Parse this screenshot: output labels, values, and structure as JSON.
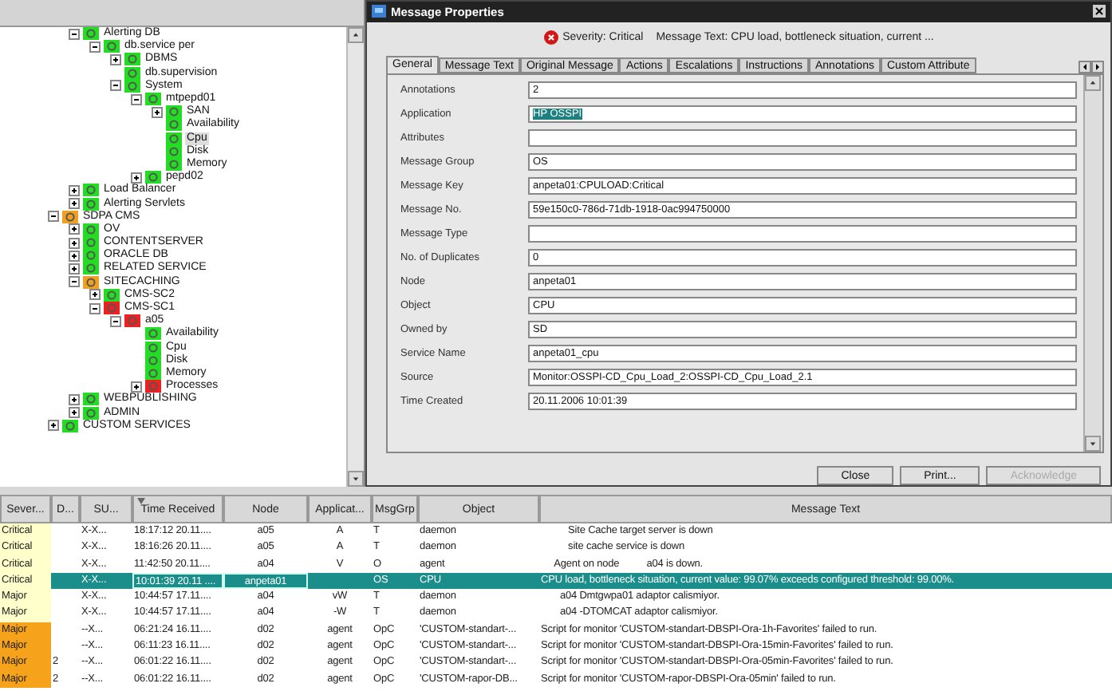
{
  "tree": {
    "continued": [
      {
        "label": "Alerting DB",
        "color": "#22dd22",
        "selected": false,
        "expanded": true,
        "children": [
          {
            "label": "db.service per",
            "color": "#22dd22",
            "selected": false,
            "expanded": true,
            "children": [
              {
                "label": "DBMS",
                "color": "#22dd22",
                "selected": false,
                "expanded": false
              },
              {
                "label": "db.supervision",
                "color": "#22dd22",
                "selected": false
              },
              {
                "label": "System",
                "color": "#22dd22",
                "selected": false,
                "expanded": true,
                "children": [
                  {
                    "label": "mtpepd01",
                    "color": "#22dd22",
                    "selected": false,
                    "expanded": true,
                    "children": [
                      {
                        "label": "SAN",
                        "color": "#22dd22",
                        "selected": false,
                        "expanded": false
                      },
                      {
                        "label": "Availability",
                        "color": "#22dd22",
                        "selected": false
                      },
                      {
                        "label": "Cpu",
                        "color": "#22dd22",
                        "selected": true
                      },
                      {
                        "label": "Disk",
                        "color": "#22dd22",
                        "selected": false
                      },
                      {
                        "label": "Memory",
                        "color": "#22dd22",
                        "selected": false
                      }
                    ]
                  },
                  {
                    "label": "pepd02",
                    "color": "#22dd22",
                    "selected": false,
                    "expanded": false
                  }
                ]
              }
            ]
          }
        ]
      },
      {
        "label": "Load Balancer",
        "color": "#22dd22",
        "selected": false,
        "expanded": false
      },
      {
        "label": "Alerting Servlets",
        "color": "#22dd22",
        "selected": false,
        "expanded": false
      }
    ],
    "items": [
      {
        "label": "SDPA CMS",
        "color": "#f0a020",
        "selected": false,
        "expanded": true,
        "children": [
          {
            "label": "OV",
            "color": "#22dd22",
            "selected": false,
            "expanded": false
          },
          {
            "label": "CONTENTSERVER",
            "color": "#22dd22",
            "selected": false,
            "expanded": false
          },
          {
            "label": "ORACLE DB",
            "color": "#22dd22",
            "selected": false,
            "expanded": false
          },
          {
            "label": "RELATED SERVICE",
            "color": "#22dd22",
            "selected": false,
            "expanded": false
          },
          {
            "label": "SITECACHING",
            "color": "#f0a020",
            "selected": false,
            "expanded": true,
            "children": [
              {
                "label": "CMS-SC2",
                "color": "#22dd22",
                "selected": false,
                "expanded": false
              },
              {
                "label": "CMS-SC1",
                "color": "#ee2020",
                "selected": false,
                "expanded": true,
                "children": [
                  {
                    "label": "a05",
                    "color": "#ee2020",
                    "selected": false,
                    "expanded": true,
                    "children": [
                      {
                        "label": "Availability",
                        "color": "#22dd22",
                        "selected": false
                      },
                      {
                        "label": "Cpu",
                        "color": "#22dd22",
                        "selected": false
                      },
                      {
                        "label": "Disk",
                        "color": "#22dd22",
                        "selected": false
                      },
                      {
                        "label": "Memory",
                        "color": "#22dd22",
                        "selected": false
                      },
                      {
                        "label": "Processes",
                        "color": "#ee2020",
                        "selected": false,
                        "expanded": false
                      }
                    ]
                  }
                ]
              }
            ]
          },
          {
            "label": "WEBPUBLISHING",
            "color": "#22dd22",
            "selected": false,
            "expanded": false
          },
          {
            "label": "ADMIN",
            "color": "#22dd22",
            "selected": false,
            "expanded": false
          }
        ]
      },
      {
        "label": "CUSTOM SERVICES",
        "color": "#22dd22",
        "selected": false,
        "expanded": false
      }
    ]
  },
  "dialog": {
    "title": "Message Properties",
    "severity": "Severity: Critical",
    "message": "Message Text: CPU load, bottleneck situation, current ...",
    "tabs": [
      {
        "label": "General",
        "selected": true
      },
      {
        "label": "Message Text",
        "selected": false
      },
      {
        "label": "Original Message",
        "selected": false
      },
      {
        "label": "Actions",
        "selected": false
      },
      {
        "label": "Escalations",
        "selected": false
      },
      {
        "label": "Instructions",
        "selected": false
      },
      {
        "label": "Annotations",
        "selected": false
      },
      {
        "label": "Custom Attribute",
        "selected": false
      }
    ],
    "fields": [
      {
        "label": "Annotations",
        "value": "2",
        "highlighted": false
      },
      {
        "label": "Application",
        "value": "HP OSSPI",
        "highlighted": true
      },
      {
        "label": "Attributes"
      },
      {
        "label": "Message Group",
        "value": "OS",
        "highlighted": false
      },
      {
        "label": "Message Key",
        "value": "anpeta01:CPULOAD:Critical",
        "highlighted": false
      },
      {
        "label": "Message No.",
        "value": "59e150c0-786d-71db-1918-0ac994750000",
        "highlighted": false
      },
      {
        "label": "Message Type"
      },
      {
        "label": "No. of Duplicates",
        "value": "0",
        "highlighted": false
      },
      {
        "label": "Node",
        "value": "anpeta01",
        "highlighted": false
      },
      {
        "label": "Object",
        "value": "CPU",
        "highlighted": false
      },
      {
        "label": "Owned by",
        "value": "SD",
        "highlighted": false
      },
      {
        "label": "Service Name",
        "value": "anpeta01_cpu",
        "highlighted": false
      },
      {
        "label": "Source",
        "value": "Monitor:OSSPI-CD_Cpu_Load_2:OSSPI-CD_Cpu_Load_2.1",
        "highlighted": false
      },
      {
        "label": "Time Created",
        "value": "20.11.2006 10:01:39",
        "highlighted": false
      }
    ],
    "buttons": [
      {
        "label": "Close",
        "disabled": false
      },
      {
        "label": "Print...",
        "disabled": false
      },
      {
        "label": "Acknowledge",
        "disabled": true
      }
    ]
  },
  "table": {
    "columns": [
      {
        "label": "Sever...",
        "sorted": false
      },
      {
        "label": "D...",
        "sorted": false
      },
      {
        "label": "SU...",
        "sorted": false
      },
      {
        "label": "Time Received",
        "sorted": true
      },
      {
        "label": "Node",
        "sorted": false
      },
      {
        "label": "Applicat...",
        "sorted": false
      },
      {
        "label": "MsgGrp",
        "sorted": false
      },
      {
        "label": "Object",
        "sorted": false
      },
      {
        "label": "Message Text",
        "sorted": false
      }
    ],
    "rows": [
      {
        "color": "#ffffcc",
        "selected": false,
        "cells": [
          "Critical",
          "",
          "X-X...",
          "18:17:12 20.11....",
          "a05",
          "A",
          "T",
          "daemon",
          "          Site Cache target server is down"
        ]
      },
      {
        "color": "#ffffcc",
        "selected": false,
        "cells": [
          "Critical",
          "",
          "X-X...",
          "18:16:26 20.11....",
          "a05",
          "A",
          "T",
          "daemon",
          "          site cache service is down"
        ]
      },
      {
        "color": "#ffffcc",
        "selected": false,
        "cells": [
          "Critical",
          "",
          "X-X...",
          "11:42:50 20.11....",
          "a04",
          "V",
          "O",
          "agent",
          "     Agent on node          a04 is down."
        ]
      },
      {
        "color": "#ffffcc",
        "selected": true,
        "cells": [
          "Critical",
          "",
          "X-X...",
          "10:01:39 20.11 ....",
          "anpeta01",
          "",
          "OS",
          "CPU",
          "CPU load, bottleneck situation, current value: 99.07% exceeds configured threshold: 99.00%."
        ]
      },
      {
        "color": "#ffffcc",
        "selected": false,
        "cells": [
          "Major",
          "",
          "X-X...",
          "10:44:57 17.11....",
          "a04",
          "vW",
          "T",
          "daemon",
          "       a04 Dmtgwpa01 adaptor calismiyor."
        ]
      },
      {
        "color": "#ffffcc",
        "selected": false,
        "cells": [
          "Major",
          "",
          "X-X...",
          "10:44:57 17.11....",
          "a04",
          "-W",
          "T",
          "daemon",
          "       a04 -DTOMCAT adaptor calismiyor."
        ]
      },
      {
        "color": "#f7a21b",
        "selected": false,
        "cells": [
          "Major",
          "",
          "--X...",
          "06:21:24 16.11....",
          "d02",
          "agent",
          "OpC",
          "'CUSTOM-standart-...",
          "Script for monitor 'CUSTOM-standart-DBSPI-Ora-1h-Favorites' failed to run."
        ]
      },
      {
        "color": "#f7a21b",
        "selected": false,
        "cells": [
          "Major",
          "",
          "--X...",
          "06:11:23 16.11....",
          "d02",
          "agent",
          "OpC",
          "'CUSTOM-standart-...",
          "Script for monitor 'CUSTOM-standart-DBSPI-Ora-15min-Favorites' failed to run."
        ]
      },
      {
        "color": "#f7a21b",
        "selected": false,
        "cells": [
          "Major",
          "2",
          "--X...",
          "06:01:22 16.11....",
          "d02",
          "agent",
          "OpC",
          "'CUSTOM-standart-...",
          "Script for monitor 'CUSTOM-standart-DBSPI-Ora-05min-Favorites' failed to run."
        ]
      },
      {
        "color": "#f7a21b",
        "selected": false,
        "cells": [
          "Major",
          "2",
          "--X...",
          "06:01:22 16.11....",
          "d02",
          "agent",
          "OpC",
          "'CUSTOM-rapor-DB...",
          "Script for monitor 'CUSTOM-rapor-DBSPI-Ora-05min' failed to run."
        ]
      }
    ]
  }
}
